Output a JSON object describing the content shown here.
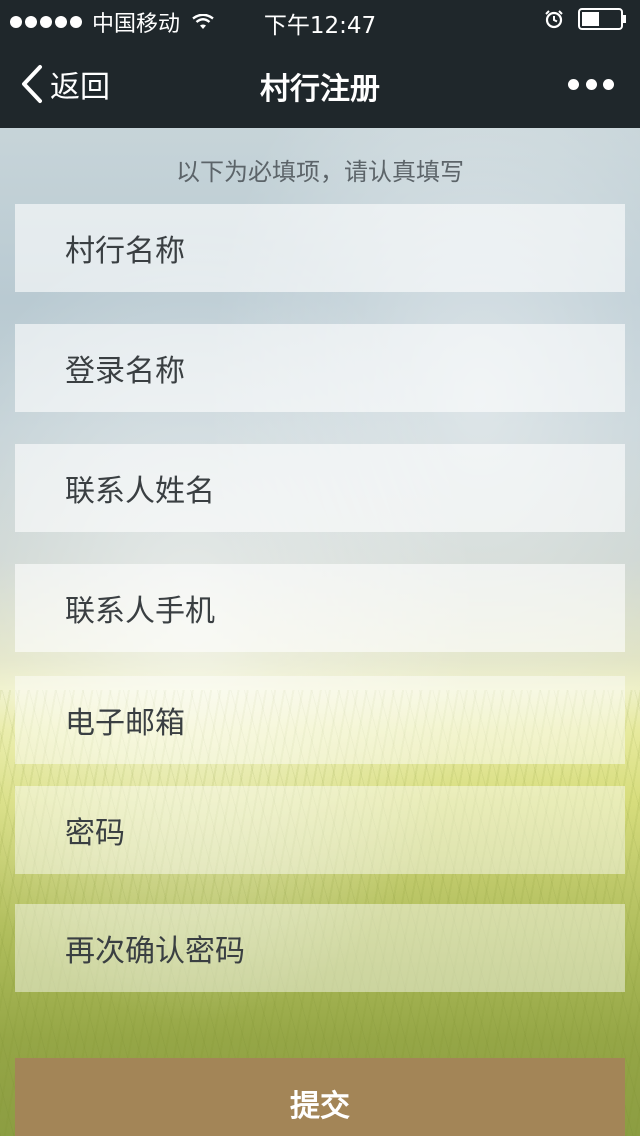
{
  "status_bar": {
    "carrier": "中国移动",
    "time": "下午12:47",
    "icons": [
      "signal-dots-icon",
      "wifi-icon",
      "alarm-icon",
      "battery-icon"
    ]
  },
  "nav": {
    "back_label": "返回",
    "title": "村行注册",
    "more_icon": "more-dots-icon"
  },
  "form": {
    "hint": "以下为必填项，请认真填写",
    "fields": [
      {
        "placeholder": "村行名称"
      },
      {
        "placeholder": "登录名称"
      },
      {
        "placeholder": "联系人姓名"
      },
      {
        "placeholder": "联系人手机"
      },
      {
        "placeholder": "电子邮箱"
      },
      {
        "placeholder": "密码"
      },
      {
        "placeholder": "再次确认密码"
      }
    ],
    "submit_label": "提交"
  },
  "colors": {
    "bar_bg": "#1f272b",
    "submit_bg": "#a38557"
  }
}
